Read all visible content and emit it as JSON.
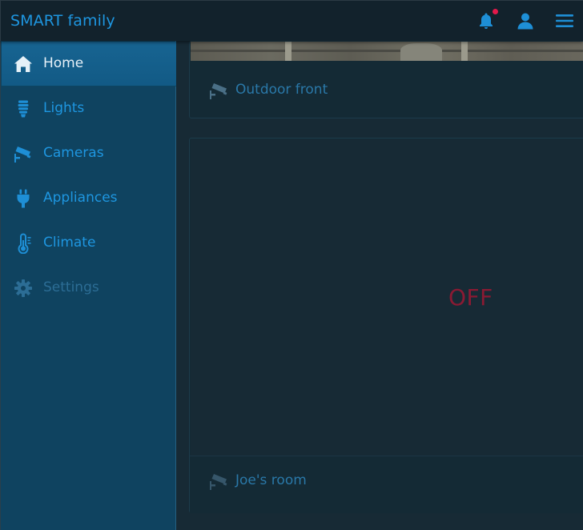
{
  "header": {
    "title": "SMART family",
    "icons": {
      "notifications": "bell-icon",
      "profile": "user-icon",
      "menu": "hamburger-menu-icon"
    }
  },
  "sidebar": {
    "items": [
      {
        "label": "Home",
        "icon": "home-icon",
        "active": true
      },
      {
        "label": "Lights",
        "icon": "lightbulb-icon",
        "active": false
      },
      {
        "label": "Cameras",
        "icon": "security-camera-icon",
        "active": false
      },
      {
        "label": "Appliances",
        "icon": "plug-icon",
        "active": false
      },
      {
        "label": "Climate",
        "icon": "thermometer-icon",
        "active": false
      },
      {
        "label": "Settings",
        "icon": "gear-icon",
        "active": false,
        "disabled": true
      }
    ]
  },
  "cameras": [
    {
      "name": "Outdoor front",
      "status": ""
    },
    {
      "name": "Joe's room",
      "status": "OFF"
    }
  ],
  "colors": {
    "accent": "#1e96e0",
    "sidebar_bg": "#0f4360",
    "sidebar_active": "#176492",
    "main_bg": "#172a35",
    "off_text": "#8a1a33",
    "notification_dot": "#e3194a"
  }
}
